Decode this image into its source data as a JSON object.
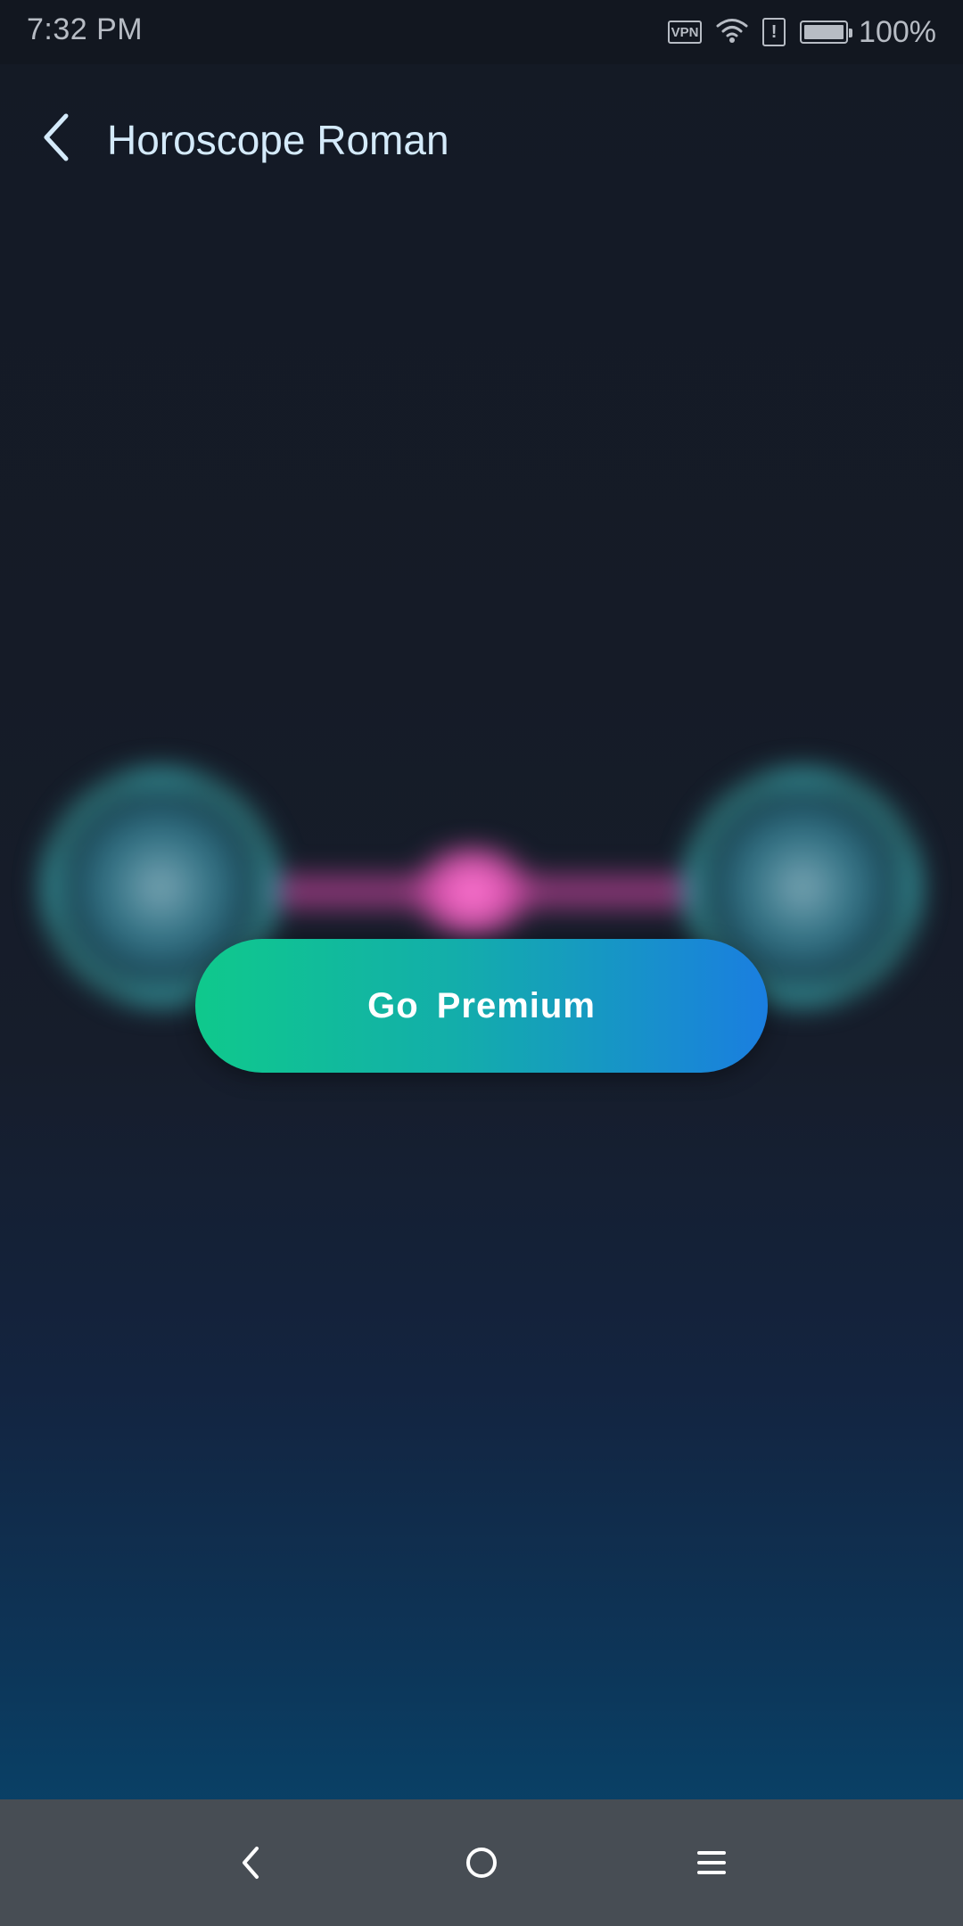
{
  "status_bar": {
    "time": "7:32 PM",
    "vpn_label": "VPN",
    "battery_text": "100%",
    "battery_level": 1.0,
    "icons": [
      "vpn-icon",
      "wifi-icon",
      "sim-alert-icon",
      "battery-icon"
    ]
  },
  "header": {
    "back_icon": "chevron-left-icon",
    "title": "Horoscope Roman"
  },
  "main": {
    "premium_button_label": "Go  Premium",
    "visual_icons": [
      "sign-circle-icon",
      "connector-glow",
      "sign-circle-icon"
    ]
  },
  "nav_bar": {
    "icons": [
      "nav-back-icon",
      "nav-home-icon",
      "nav-menu-icon"
    ]
  },
  "colors": {
    "title": "#d4eafa",
    "button_gradient_start": "#0fc98c",
    "button_gradient_end": "#1a7ee0",
    "background_top": "#141a25",
    "background_bottom": "#064a72",
    "nav_bar": "#474d54"
  }
}
